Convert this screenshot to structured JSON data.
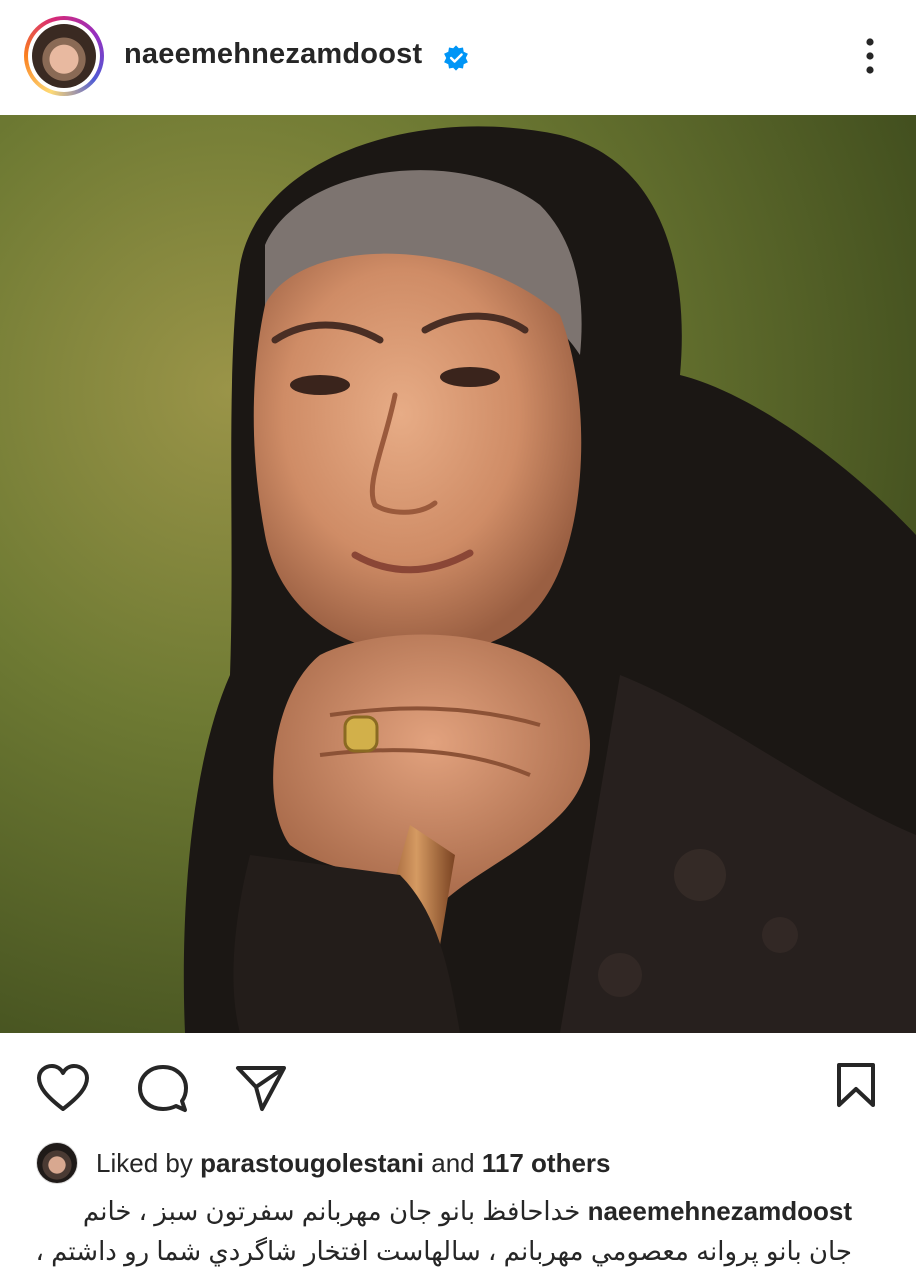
{
  "post": {
    "username": "naeemehnezamdoost",
    "verified": true
  },
  "likes": {
    "prefix": "Liked by",
    "user": "parastougolestani",
    "middle": "and",
    "count_text": "117 others"
  },
  "caption": {
    "username": "naeemehnezamdoost",
    "line1": "خداحافظ بانو جان مهربانم سفرتون سبز ، خانم",
    "line2": "جان بانو پروانه معصومي مهربانم ، سالهاست افتخار شاگردي شما رو داشتم ،"
  },
  "icons": {
    "verified": "verified-badge-icon",
    "more": "more-options-icon",
    "like": "heart-icon",
    "comment": "comment-icon",
    "share": "send-icon",
    "save": "bookmark-icon"
  },
  "colors": {
    "text": "#262626",
    "verified": "#0095f6",
    "photo_background": "#6f7a34",
    "scarf": "#1a1613",
    "skin": "#d89a78"
  }
}
